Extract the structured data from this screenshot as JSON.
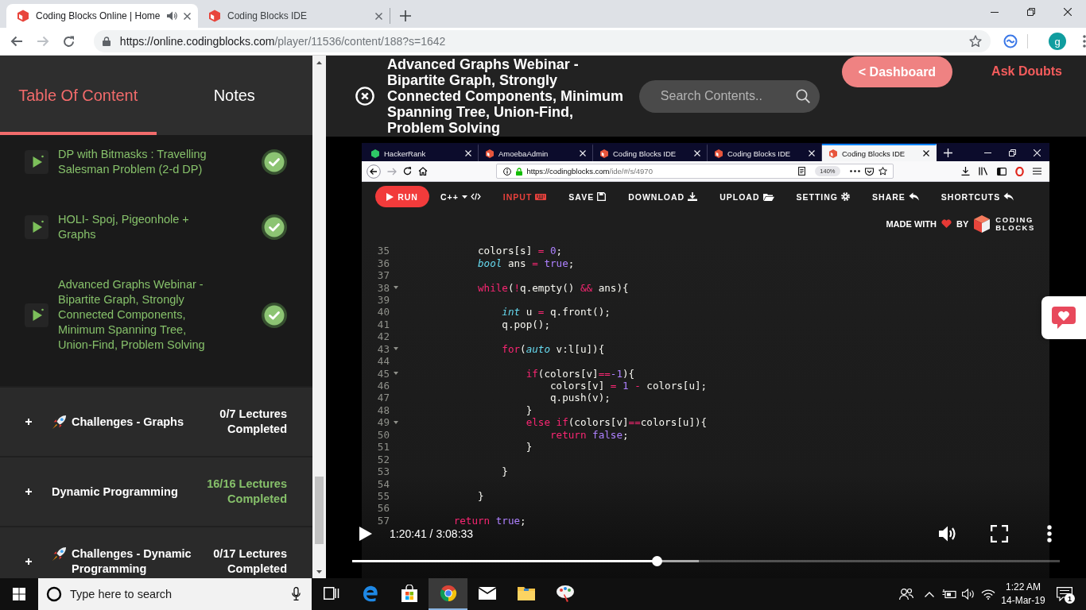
{
  "browser": {
    "tabs": [
      {
        "title": "Coding Blocks Online | Home",
        "selected": true,
        "audio": true
      },
      {
        "title": "Coding Blocks IDE",
        "selected": false,
        "audio": false
      }
    ],
    "forward": {
      "disabled": true
    },
    "url": {
      "host": "https://online.codingblocks.com",
      "path": "/player/11536/content/188?s=1642"
    },
    "profile": "g"
  },
  "sidebar": {
    "tabs": [
      {
        "label": "Table Of Content",
        "selected": true
      },
      {
        "label": "Notes",
        "selected": false
      }
    ],
    "lectures": [
      {
        "title": "DP with Bitmasks : Travelling Salesman Problem (2-d DP)",
        "completed": true
      },
      {
        "title": "HOLI- Spoj, Pigeonhole + Graphs",
        "completed": true
      },
      {
        "title": "Advanced Graphs Webinar - Bipartite Graph, Strongly Connected Components, Minimum Spanning Tree, Union-Find, Problem Solving",
        "completed": true
      }
    ],
    "sections": [
      {
        "kind": "challenge",
        "title": "Challenges - Graphs",
        "progress": "0/7 Lectures Completed",
        "completed": false,
        "expanded": false
      },
      {
        "kind": "topic",
        "title": "Dynamic Programming",
        "progress": "16/16 Lectures Completed",
        "completed": true,
        "expanded": false
      },
      {
        "kind": "challenge",
        "title": "Challenges - Dynamic Programming",
        "progress": "0/17 Lectures Completed",
        "completed": false,
        "expanded": false
      }
    ]
  },
  "player": {
    "title": "Advanced Graphs Webinar - Bipartite Graph, Strongly Connected Components, Minimum Spanning Tree, Union-Find, Problem Solving",
    "search": {
      "placeholder": "Search Contents.."
    },
    "dashboard": "< Dashboard",
    "ask_doubts": "Ask Doubts",
    "video": {
      "recording": {
        "tabs": [
          {
            "title": "HackerRank",
            "kind": "hexagon",
            "selected": false
          },
          {
            "title": "AmoebaAdmin",
            "kind": "cube",
            "selected": false
          },
          {
            "title": "Coding Blocks IDE",
            "kind": "cube",
            "selected": false
          },
          {
            "title": "Coding Blocks IDE",
            "kind": "cube",
            "selected": false
          },
          {
            "title": "Coding Blocks IDE",
            "kind": "cube",
            "selected": true
          }
        ],
        "forward": {
          "disabled": true
        },
        "url": {
          "host": "https://codingblocks.com",
          "path": "/ide/#/s/4970"
        },
        "zoom": "140%",
        "toolbar": [
          {
            "kind": "run",
            "label": "RUN"
          },
          {
            "kind": "language",
            "label": "C++"
          },
          {
            "kind": "input",
            "label": "INPUT"
          },
          {
            "kind": "save",
            "label": "SAVE"
          },
          {
            "kind": "download",
            "label": "DOWNLOAD"
          },
          {
            "kind": "upload",
            "label": "UPLOAD"
          },
          {
            "kind": "setting",
            "label": "SETTING"
          },
          {
            "kind": "share",
            "label": "SHARE"
          },
          {
            "kind": "shortcuts",
            "label": "SHORTCUTS"
          }
        ],
        "credit": {
          "before": "MADE WITH",
          "after": "BY",
          "logo": [
            "CODING",
            "BLOCKS"
          ]
        },
        "code": [
          {
            "number": "35",
            "fold": false,
            "tokens": [
              {
                "text": "            colors[s] ",
                "kind": "plain"
              },
              {
                "text": "=",
                "kind": "operator"
              },
              {
                "text": " 0",
                "kind": "constant"
              },
              {
                "text": ";",
                "kind": "plain"
              }
            ]
          },
          {
            "number": "36",
            "fold": false,
            "tokens": [
              {
                "text": "            bool",
                "kind": "type"
              },
              {
                "text": " ans ",
                "kind": "plain"
              },
              {
                "text": "=",
                "kind": "operator"
              },
              {
                "text": " true",
                "kind": "constant"
              },
              {
                "text": ";",
                "kind": "plain"
              }
            ]
          },
          {
            "number": "37",
            "fold": false
          },
          {
            "number": "38",
            "fold": true,
            "tokens": [
              {
                "text": "            while",
                "kind": "keyword"
              },
              {
                "text": "(",
                "kind": "plain"
              },
              {
                "text": "!",
                "kind": "operator"
              },
              {
                "text": "q.empty() ",
                "kind": "plain"
              },
              {
                "text": "&&",
                "kind": "operator"
              },
              {
                "text": " ans){",
                "kind": "plain"
              }
            ]
          },
          {
            "number": "39",
            "fold": false
          },
          {
            "number": "40",
            "fold": false,
            "tokens": [
              {
                "text": "                int",
                "kind": "type"
              },
              {
                "text": " u ",
                "kind": "plain"
              },
              {
                "text": "=",
                "kind": "operator"
              },
              {
                "text": " q.front();",
                "kind": "plain"
              }
            ]
          },
          {
            "number": "41",
            "fold": false,
            "tokens": [
              {
                "text": "                q.pop();",
                "kind": "plain"
              }
            ]
          },
          {
            "number": "42",
            "fold": false
          },
          {
            "number": "43",
            "fold": true,
            "tokens": [
              {
                "text": "                for",
                "kind": "keyword"
              },
              {
                "text": "(",
                "kind": "plain"
              },
              {
                "text": "auto",
                "kind": "type"
              },
              {
                "text": " v:l[u]){",
                "kind": "plain"
              }
            ]
          },
          {
            "number": "44",
            "fold": false
          },
          {
            "number": "45",
            "fold": true,
            "tokens": [
              {
                "text": "                    if",
                "kind": "keyword"
              },
              {
                "text": "(colors[v]",
                "kind": "plain"
              },
              {
                "text": "==",
                "kind": "operator"
              },
              {
                "text": "-1",
                "kind": "constant"
              },
              {
                "text": "){",
                "kind": "plain"
              }
            ]
          },
          {
            "number": "46",
            "fold": false,
            "tokens": [
              {
                "text": "                        colors[v] ",
                "kind": "plain"
              },
              {
                "text": "=",
                "kind": "operator"
              },
              {
                "text": " 1 ",
                "kind": "constant"
              },
              {
                "text": "-",
                "kind": "operator"
              },
              {
                "text": " colors[u];",
                "kind": "plain"
              }
            ]
          },
          {
            "number": "47",
            "fold": false,
            "tokens": [
              {
                "text": "                        q.push(v);",
                "kind": "plain"
              }
            ]
          },
          {
            "number": "48",
            "fold": false,
            "tokens": [
              {
                "text": "                    }",
                "kind": "plain"
              }
            ]
          },
          {
            "number": "49",
            "fold": true,
            "tokens": [
              {
                "text": "                    else if",
                "kind": "keyword"
              },
              {
                "text": "(colors[v]",
                "kind": "plain"
              },
              {
                "text": "==",
                "kind": "operator"
              },
              {
                "text": "colors[u]){",
                "kind": "plain"
              }
            ]
          },
          {
            "number": "50",
            "fold": false,
            "tokens": [
              {
                "text": "                        return",
                "kind": "keyword"
              },
              {
                "text": " false",
                "kind": "constant"
              },
              {
                "text": ";",
                "kind": "plain"
              }
            ]
          },
          {
            "number": "51",
            "fold": false,
            "tokens": [
              {
                "text": "                    }",
                "kind": "plain"
              }
            ]
          },
          {
            "number": "52",
            "fold": false
          },
          {
            "number": "53",
            "fold": false,
            "tokens": [
              {
                "text": "                }",
                "kind": "plain"
              }
            ]
          },
          {
            "number": "54",
            "fold": false
          },
          {
            "number": "55",
            "fold": false,
            "tokens": [
              {
                "text": "            }",
                "kind": "plain"
              }
            ]
          },
          {
            "number": "56",
            "fold": false
          },
          {
            "number": "57",
            "fold": false,
            "tokens": [
              {
                "text": "        return",
                "kind": "keyword"
              },
              {
                "text": " true",
                "kind": "constant"
              },
              {
                "text": ";",
                "kind": "plain"
              }
            ]
          }
        ]
      },
      "controls": {
        "playing": false,
        "time": "1:20:41 / 3:08:33",
        "progress": {
          "level": 0.43
        },
        "buffer": {
          "level": 0.49
        }
      }
    }
  },
  "taskbar": {
    "search": {
      "placeholder": "Type here to search"
    },
    "apps": [
      {
        "kind": "task-view",
        "selected": false
      },
      {
        "kind": "edge",
        "selected": false
      },
      {
        "kind": "store",
        "selected": false
      },
      {
        "kind": "chrome",
        "selected": true
      },
      {
        "kind": "mail",
        "selected": false
      },
      {
        "kind": "explorer",
        "selected": false
      },
      {
        "kind": "paint",
        "selected": false
      }
    ],
    "time": "1:22 AM",
    "date": "14-Mar-19",
    "notifications": "1"
  }
}
